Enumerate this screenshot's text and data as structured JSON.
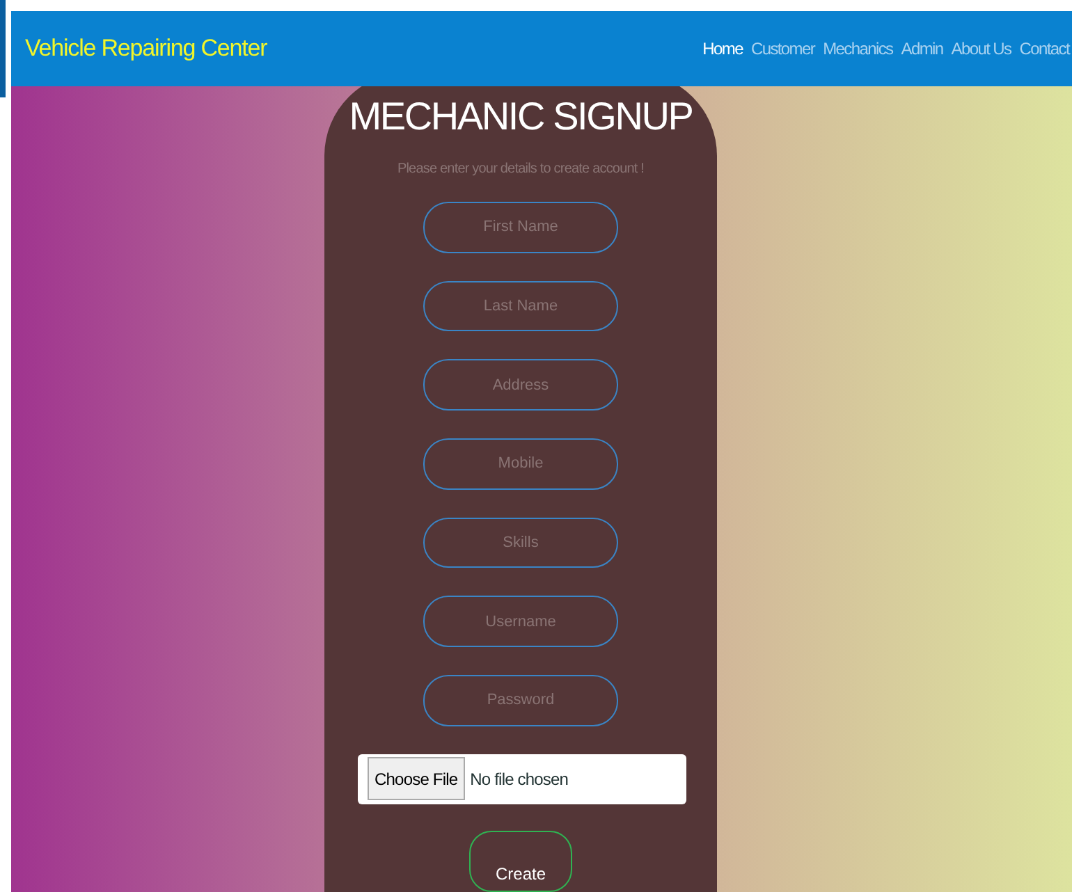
{
  "navbar": {
    "brand": "Vehicle Repairing Center",
    "links": [
      {
        "label": "Home",
        "selected": true
      },
      {
        "label": "Customer",
        "selected": false
      },
      {
        "label": "Mechanics",
        "selected": false
      },
      {
        "label": "Admin",
        "selected": false
      },
      {
        "label": "About Us",
        "selected": false
      },
      {
        "label": "Contact",
        "selected": false
      }
    ]
  },
  "form": {
    "title": "MECHANIC SIGNUP",
    "subtitle": "Please enter your details to create account !",
    "fields": [
      {
        "placeholder": "First Name"
      },
      {
        "placeholder": "Last Name"
      },
      {
        "placeholder": "Address"
      },
      {
        "placeholder": "Mobile"
      },
      {
        "placeholder": "Skills"
      },
      {
        "placeholder": "Username"
      },
      {
        "placeholder": "Password"
      }
    ],
    "file": {
      "button": "Choose File",
      "status": "No file chosen"
    },
    "submit": "Create"
  }
}
